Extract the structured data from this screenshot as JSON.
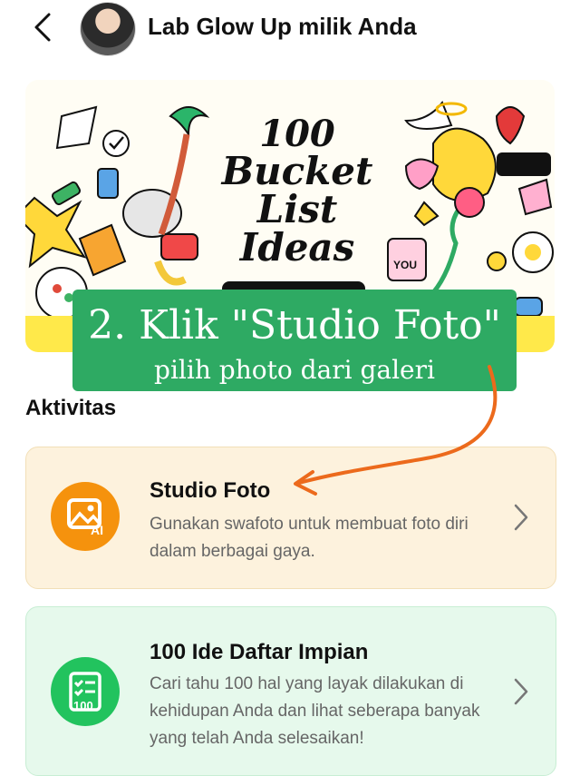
{
  "header": {
    "title": "Lab Glow Up milik Anda",
    "back_icon": "chevron-left-icon"
  },
  "banner": {
    "line1": "100",
    "line2": "Bucket",
    "line3": "List",
    "line4": "Ideas"
  },
  "overlay": {
    "line1": "2. Klik \"Studio Foto\"",
    "line2": "pilih photo dari galeri",
    "color": "#2eaa63",
    "arrow_color": "#ec6a1c"
  },
  "section": {
    "title": "Aktivitas"
  },
  "cards": [
    {
      "title": "Studio Foto",
      "description": "Gunakan swafoto untuk membuat foto diri dalam berbagai gaya.",
      "icon": "image-ai-icon",
      "icon_color": "#f5920d",
      "bg": "#fdf2dd"
    },
    {
      "title": "100 Ide Daftar Impian",
      "description": "Cari tahu 100 hal yang layak dilakukan di kehidupan Anda dan lihat seberapa banyak yang telah Anda selesaikan!",
      "icon": "checklist-100-icon",
      "icon_color": "#22c35e",
      "bg": "#e6f9ec"
    }
  ]
}
